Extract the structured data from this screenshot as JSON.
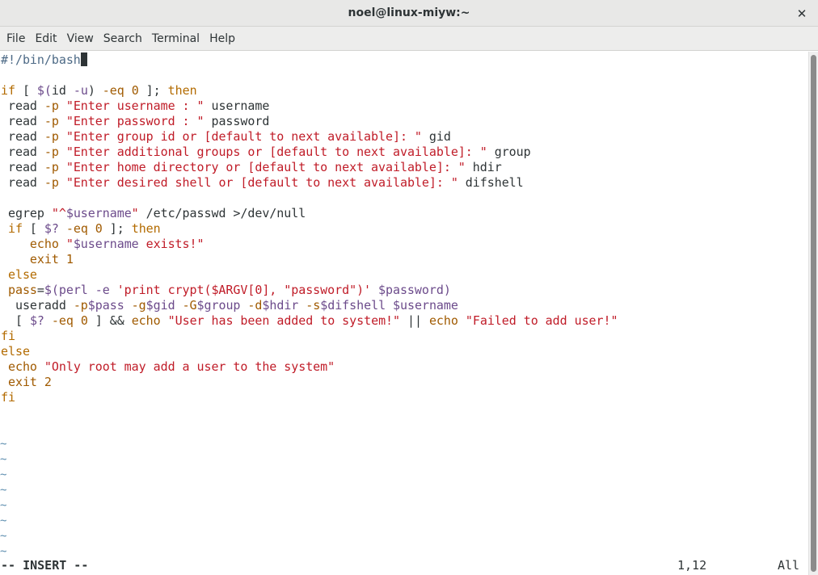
{
  "window": {
    "title": "noel@linux-miyw:~",
    "close_icon": "close-icon"
  },
  "menu": [
    "File",
    "Edit",
    "View",
    "Search",
    "Terminal",
    "Help"
  ],
  "code": [
    [
      [
        "comment",
        "#!/bin/bash"
      ],
      [
        "cursor",
        ""
      ]
    ],
    [],
    [
      [
        "keyword",
        "if"
      ],
      [
        "plain",
        " [ "
      ],
      [
        "var",
        "$("
      ],
      [
        "plain",
        "id"
      ],
      [
        "var",
        " -u"
      ],
      [
        "plain",
        ") "
      ],
      [
        "brown",
        "-eq"
      ],
      [
        "plain",
        " "
      ],
      [
        "brown",
        "0"
      ],
      [
        "plain",
        " ]; "
      ],
      [
        "keyword",
        "then"
      ]
    ],
    [
      [
        "plain",
        " read "
      ],
      [
        "brown",
        "-p"
      ],
      [
        "plain",
        " "
      ],
      [
        "string",
        "\"Enter username : \""
      ],
      [
        "plain",
        " username"
      ]
    ],
    [
      [
        "plain",
        " read "
      ],
      [
        "brown",
        "-p"
      ],
      [
        "plain",
        " "
      ],
      [
        "string",
        "\"Enter password : \""
      ],
      [
        "plain",
        " password"
      ]
    ],
    [
      [
        "plain",
        " read "
      ],
      [
        "brown",
        "-p"
      ],
      [
        "plain",
        " "
      ],
      [
        "string",
        "\"Enter group id or [default to next available]: \""
      ],
      [
        "plain",
        " gid"
      ]
    ],
    [
      [
        "plain",
        " read "
      ],
      [
        "brown",
        "-p"
      ],
      [
        "plain",
        " "
      ],
      [
        "string",
        "\"Enter additional groups or [default to next available]: \""
      ],
      [
        "plain",
        " group"
      ]
    ],
    [
      [
        "plain",
        " read "
      ],
      [
        "brown",
        "-p"
      ],
      [
        "plain",
        " "
      ],
      [
        "string",
        "\"Enter home directory or [default to next available]: \""
      ],
      [
        "plain",
        " hdir"
      ]
    ],
    [
      [
        "plain",
        " read "
      ],
      [
        "brown",
        "-p"
      ],
      [
        "plain",
        " "
      ],
      [
        "string",
        "\"Enter desired shell or [default to next available]: \""
      ],
      [
        "plain",
        " difshell"
      ]
    ],
    [],
    [
      [
        "plain",
        " egrep "
      ],
      [
        "string",
        "\"^"
      ],
      [
        "var",
        "$username"
      ],
      [
        "string",
        "\""
      ],
      [
        "plain",
        " /etc/passwd >/dev/null"
      ]
    ],
    [
      [
        "keyword",
        " if"
      ],
      [
        "plain",
        " [ "
      ],
      [
        "var",
        "$?"
      ],
      [
        "plain",
        " "
      ],
      [
        "brown",
        "-eq"
      ],
      [
        "plain",
        " "
      ],
      [
        "brown",
        "0"
      ],
      [
        "plain",
        " ]; "
      ],
      [
        "keyword",
        "then"
      ]
    ],
    [
      [
        "brown",
        "    echo"
      ],
      [
        "plain",
        " "
      ],
      [
        "string",
        "\""
      ],
      [
        "var",
        "$username"
      ],
      [
        "string",
        " exists!\""
      ]
    ],
    [
      [
        "brown",
        "    exit"
      ],
      [
        "plain",
        " "
      ],
      [
        "brown",
        "1"
      ]
    ],
    [
      [
        "keyword",
        " else"
      ]
    ],
    [
      [
        "brown",
        " pass"
      ],
      [
        "plain",
        "="
      ],
      [
        "var",
        "$(perl -e "
      ],
      [
        "string",
        "'print crypt($ARGV[0], \"password\")'"
      ],
      [
        "var",
        " $password)"
      ]
    ],
    [
      [
        "plain",
        "  useradd "
      ],
      [
        "brown",
        "-p"
      ],
      [
        "var",
        "$pass"
      ],
      [
        "plain",
        " "
      ],
      [
        "brown",
        "-g"
      ],
      [
        "var",
        "$gid"
      ],
      [
        "plain",
        " "
      ],
      [
        "brown",
        "-G"
      ],
      [
        "var",
        "$group"
      ],
      [
        "plain",
        " "
      ],
      [
        "brown",
        "-d"
      ],
      [
        "var",
        "$hdir"
      ],
      [
        "plain",
        " "
      ],
      [
        "brown",
        "-s"
      ],
      [
        "var",
        "$difshell"
      ],
      [
        "plain",
        " "
      ],
      [
        "var",
        "$username"
      ]
    ],
    [
      [
        "plain",
        "  [ "
      ],
      [
        "var",
        "$?"
      ],
      [
        "plain",
        " "
      ],
      [
        "brown",
        "-eq"
      ],
      [
        "plain",
        " "
      ],
      [
        "brown",
        "0"
      ],
      [
        "plain",
        " ] && "
      ],
      [
        "brown",
        "echo"
      ],
      [
        "plain",
        " "
      ],
      [
        "string",
        "\"User has been added to system!\""
      ],
      [
        "plain",
        " || "
      ],
      [
        "brown",
        "echo"
      ],
      [
        "plain",
        " "
      ],
      [
        "string",
        "\"Failed to add user!\""
      ]
    ],
    [
      [
        "keyword",
        "fi"
      ]
    ],
    [
      [
        "keyword",
        "else"
      ]
    ],
    [
      [
        "brown",
        " echo"
      ],
      [
        "plain",
        " "
      ],
      [
        "string",
        "\"Only root may add a user to the system\""
      ]
    ],
    [
      [
        "brown",
        " exit"
      ],
      [
        "plain",
        " "
      ],
      [
        "brown",
        "2"
      ]
    ],
    [
      [
        "keyword",
        "fi"
      ]
    ]
  ],
  "tildes": [
    "~",
    "~",
    "~",
    "~",
    "~",
    "~",
    "~",
    "~"
  ],
  "status": {
    "mode": "-- INSERT --",
    "position": "1,12",
    "scroll": "All"
  },
  "colors": {
    "comment": "#4d6a86",
    "keyword": "#b36b00",
    "string": "#c01c28",
    "variable": "#6c4b8b"
  }
}
